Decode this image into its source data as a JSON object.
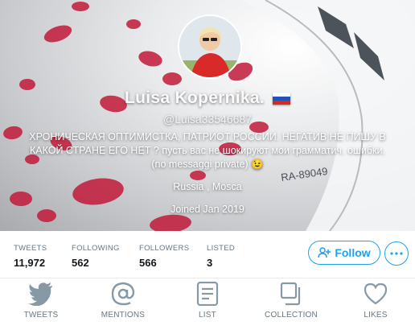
{
  "profile": {
    "name": "Luisa Kopernika.",
    "handle": "@Luisa33546687",
    "bio": "ХРОНИЧЕСКАЯ ОПТИМИСТКА, ПАТРИОТ РОССИИ. НЕГАТИВ НЕ ПИШУ В КАКОЙ СТРАНЕ ЕГО НЕТ ? пусть вас не шокируют мои грамматич. ошибки. (no messaggi private) 😉",
    "location": "Russia , Mosca",
    "joined": "Joined Jan 2019"
  },
  "stats": [
    {
      "label": "TWEETS",
      "value": "11,972"
    },
    {
      "label": "FOLLOWING",
      "value": "562"
    },
    {
      "label": "FOLLOWERS",
      "value": "566"
    },
    {
      "label": "LISTED",
      "value": "3"
    }
  ],
  "actions": {
    "follow_label": "Follow",
    "more_icon": "more-dots-icon"
  },
  "tabs": [
    {
      "label": "TWEETS",
      "icon": "bird-icon"
    },
    {
      "label": "MENTIONS",
      "icon": "at-icon"
    },
    {
      "label": "LIST",
      "icon": "list-icon"
    },
    {
      "label": "COLLECTION",
      "icon": "collection-icon"
    },
    {
      "label": "LIKES",
      "icon": "heart-icon"
    }
  ],
  "colors": {
    "accent": "#1da1f2",
    "icon_gray": "#8899a6",
    "label_gray": "#657786",
    "lipstick": "#c21a3a"
  }
}
